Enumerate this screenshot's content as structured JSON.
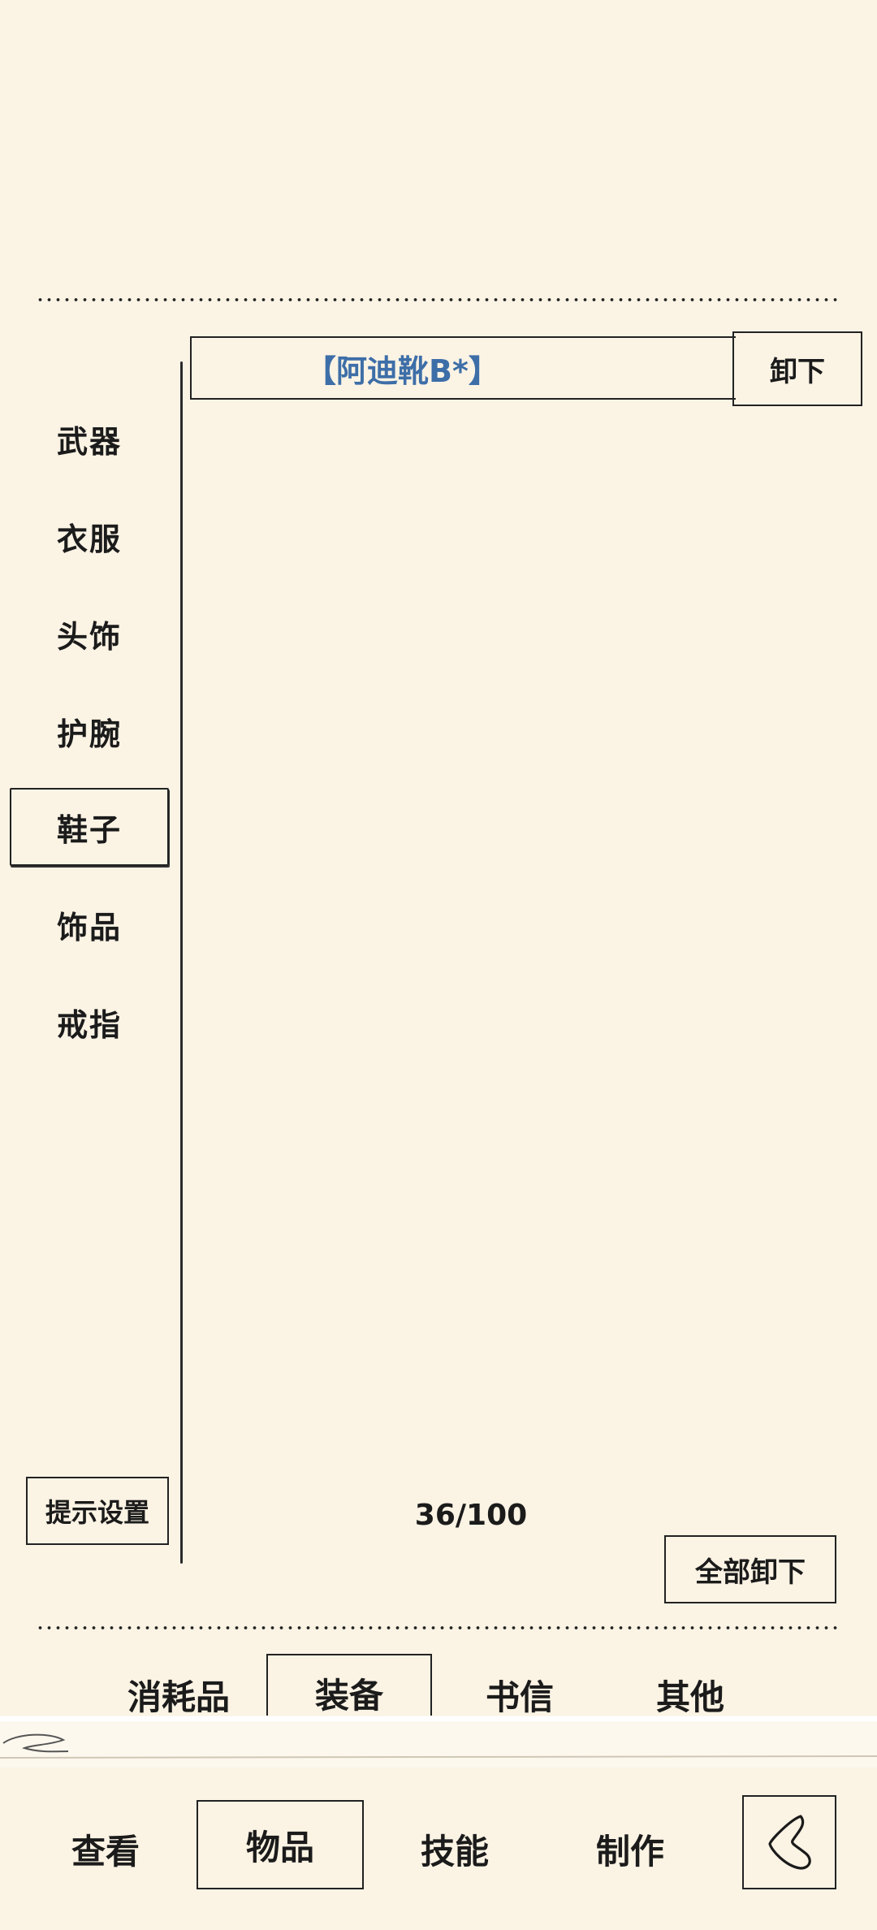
{
  "colors": {
    "background": "#fbf3e4",
    "item_accent": "#3d6ea8",
    "ink": "#1b1b1b"
  },
  "categories": [
    {
      "label": "武器"
    },
    {
      "label": "衣服"
    },
    {
      "label": "头饰"
    },
    {
      "label": "护腕"
    },
    {
      "label": "鞋子",
      "selected": true
    },
    {
      "label": "饰品"
    },
    {
      "label": "戒指"
    }
  ],
  "equipped_item": {
    "name": "【阿迪靴B*】",
    "unequip_label": "卸下"
  },
  "hint_settings_label": "提示设置",
  "capacity": "36/100",
  "unequip_all_label": "全部卸下",
  "sub_tabs": [
    {
      "label": "消耗品"
    },
    {
      "label": "装备",
      "selected": true
    },
    {
      "label": "书信"
    },
    {
      "label": "其他"
    }
  ],
  "bottom_nav": [
    {
      "label": "查看"
    },
    {
      "label": "物品",
      "selected": true
    },
    {
      "label": "技能"
    },
    {
      "label": "制作"
    }
  ],
  "back_icon": "back-arrow-icon"
}
